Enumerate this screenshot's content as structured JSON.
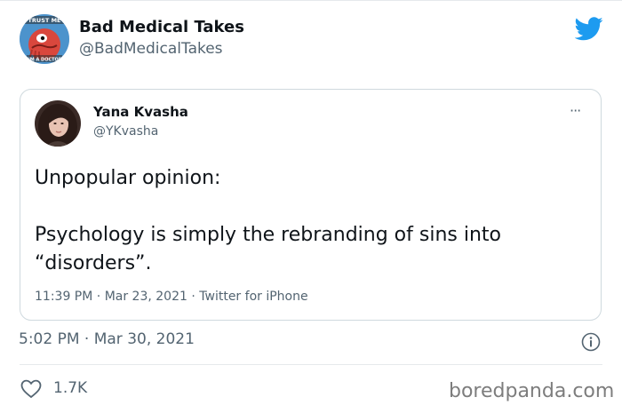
{
  "tweet": {
    "author_name": "Bad Medical Takes",
    "author_handle": "@BadMedicalTakes",
    "avatar_text": [
      "TRUST ME",
      "I'M A DOCTOR"
    ],
    "timestamp": "5:02 PM · Mar 30, 2021",
    "likes": "1.7K",
    "brand_color": "#1d9bf0"
  },
  "quoted": {
    "author_name": "Yana Kvasha",
    "author_handle": "@YKvasha",
    "more_label": "···",
    "lines": [
      "Unpopular opinion:",
      "Psychology is simply the rebranding of sins into",
      "“disorders”."
    ],
    "time": "11:39 PM",
    "date": "Mar 23, 2021",
    "source": "Twitter for iPhone",
    "separator": " · "
  },
  "watermark": "boredpanda.com",
  "icons": [
    "twitter-bird-icon",
    "more-options-icon",
    "info-icon",
    "heart-icon"
  ]
}
